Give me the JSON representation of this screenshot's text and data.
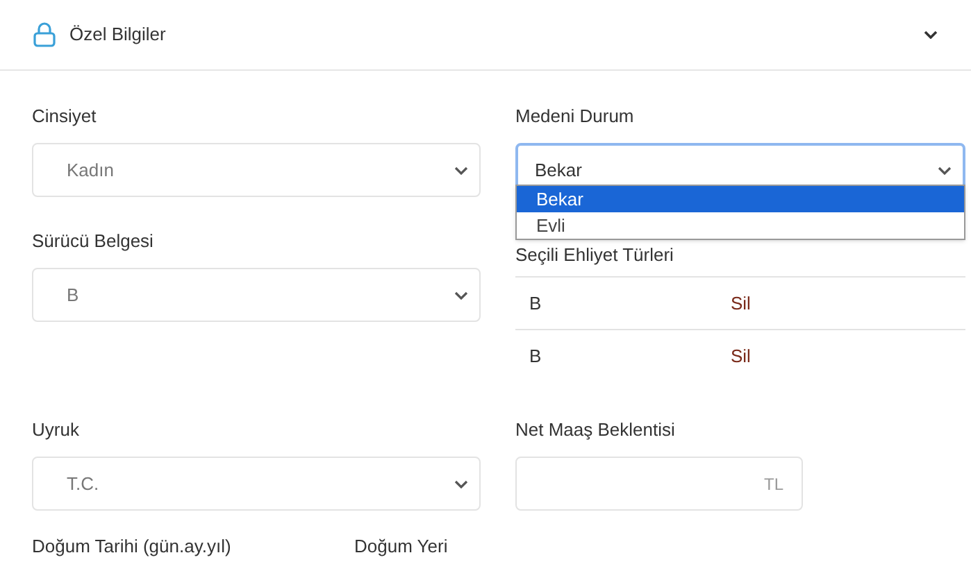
{
  "section": {
    "title": "Özel Bilgiler",
    "expanded": true
  },
  "gender": {
    "label": "Cinsiyet",
    "value": "Kadın"
  },
  "marital": {
    "label": "Medeni Durum",
    "value": "Bekar",
    "open": true,
    "options": [
      {
        "label": "Bekar",
        "selected": true
      },
      {
        "label": "Evli",
        "selected": false
      }
    ]
  },
  "license": {
    "label": "Sürücü Belgesi",
    "value": "B"
  },
  "selected_licenses": {
    "label": "Seçili Ehliyet Türleri",
    "rows": [
      {
        "type": "B",
        "action": "Sil"
      },
      {
        "type": "B",
        "action": "Sil"
      }
    ]
  },
  "nationality": {
    "label": "Uyruk",
    "value": "T.C."
  },
  "salary": {
    "label": "Net Maaş Beklentisi",
    "suffix": "TL"
  },
  "birth_date": {
    "label": "Doğum Tarihi (gün.ay.yıl)"
  },
  "birth_place": {
    "label": "Doğum Yeri"
  }
}
